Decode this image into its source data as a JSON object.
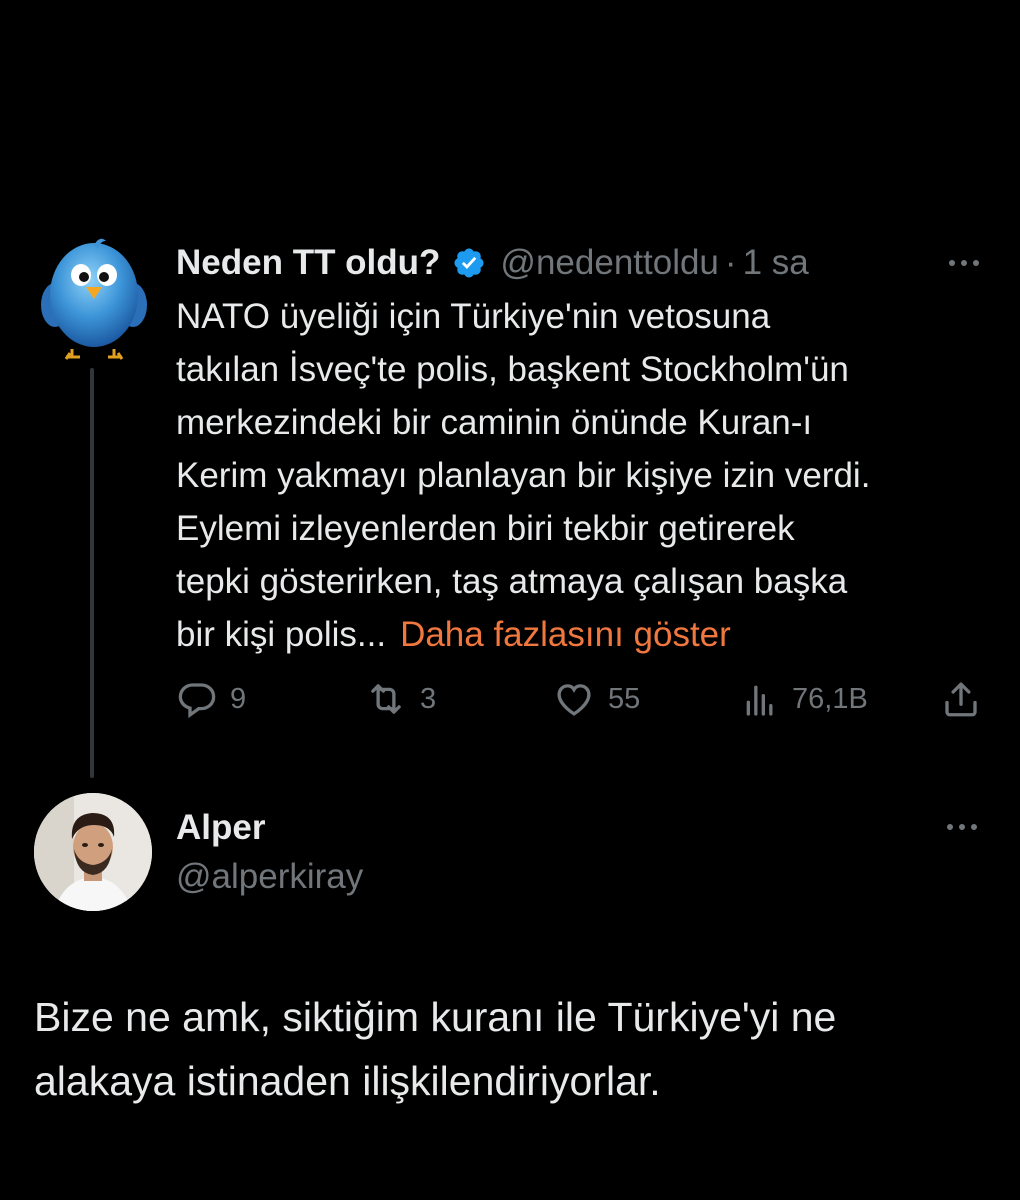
{
  "tweet": {
    "author_name": "Neden TT oldu?",
    "handle": "@nedenttoldu",
    "separator": "·",
    "time": "1 sa",
    "avatar_icon": "bluebird-icon",
    "verified_icon": "verified-badge-icon",
    "body_lines": "NATO üyeliği için Türkiye'nin vetosuna\ntakılan İsveç'te polis, başkent Stockholm'ün\nmerkezindeki bir caminin önünde Kuran-ı\nKerim yakmayı planlayan bir kişiye izin verdi.\nEylemi izleyenlerden biri tekbir getirerek\ntepki gösterirken, taş atmaya çalışan başka\nbir kişi polis...",
    "show_more_label": "Daha fazlasını göster",
    "actions": {
      "replies": "9",
      "retweets": "3",
      "likes": "55",
      "views": "76,1B"
    },
    "colors": {
      "show_more": "#f0773d",
      "verified": "#1d9bf0",
      "secondary_text": "#71767b"
    }
  },
  "reply": {
    "author_name": "Alper",
    "handle": "@alperkiray",
    "text": "Bize ne amk, siktiğim kuranı ile Türkiye'yi ne\nalakaya istinaden ilişkilendiriyorlar."
  }
}
